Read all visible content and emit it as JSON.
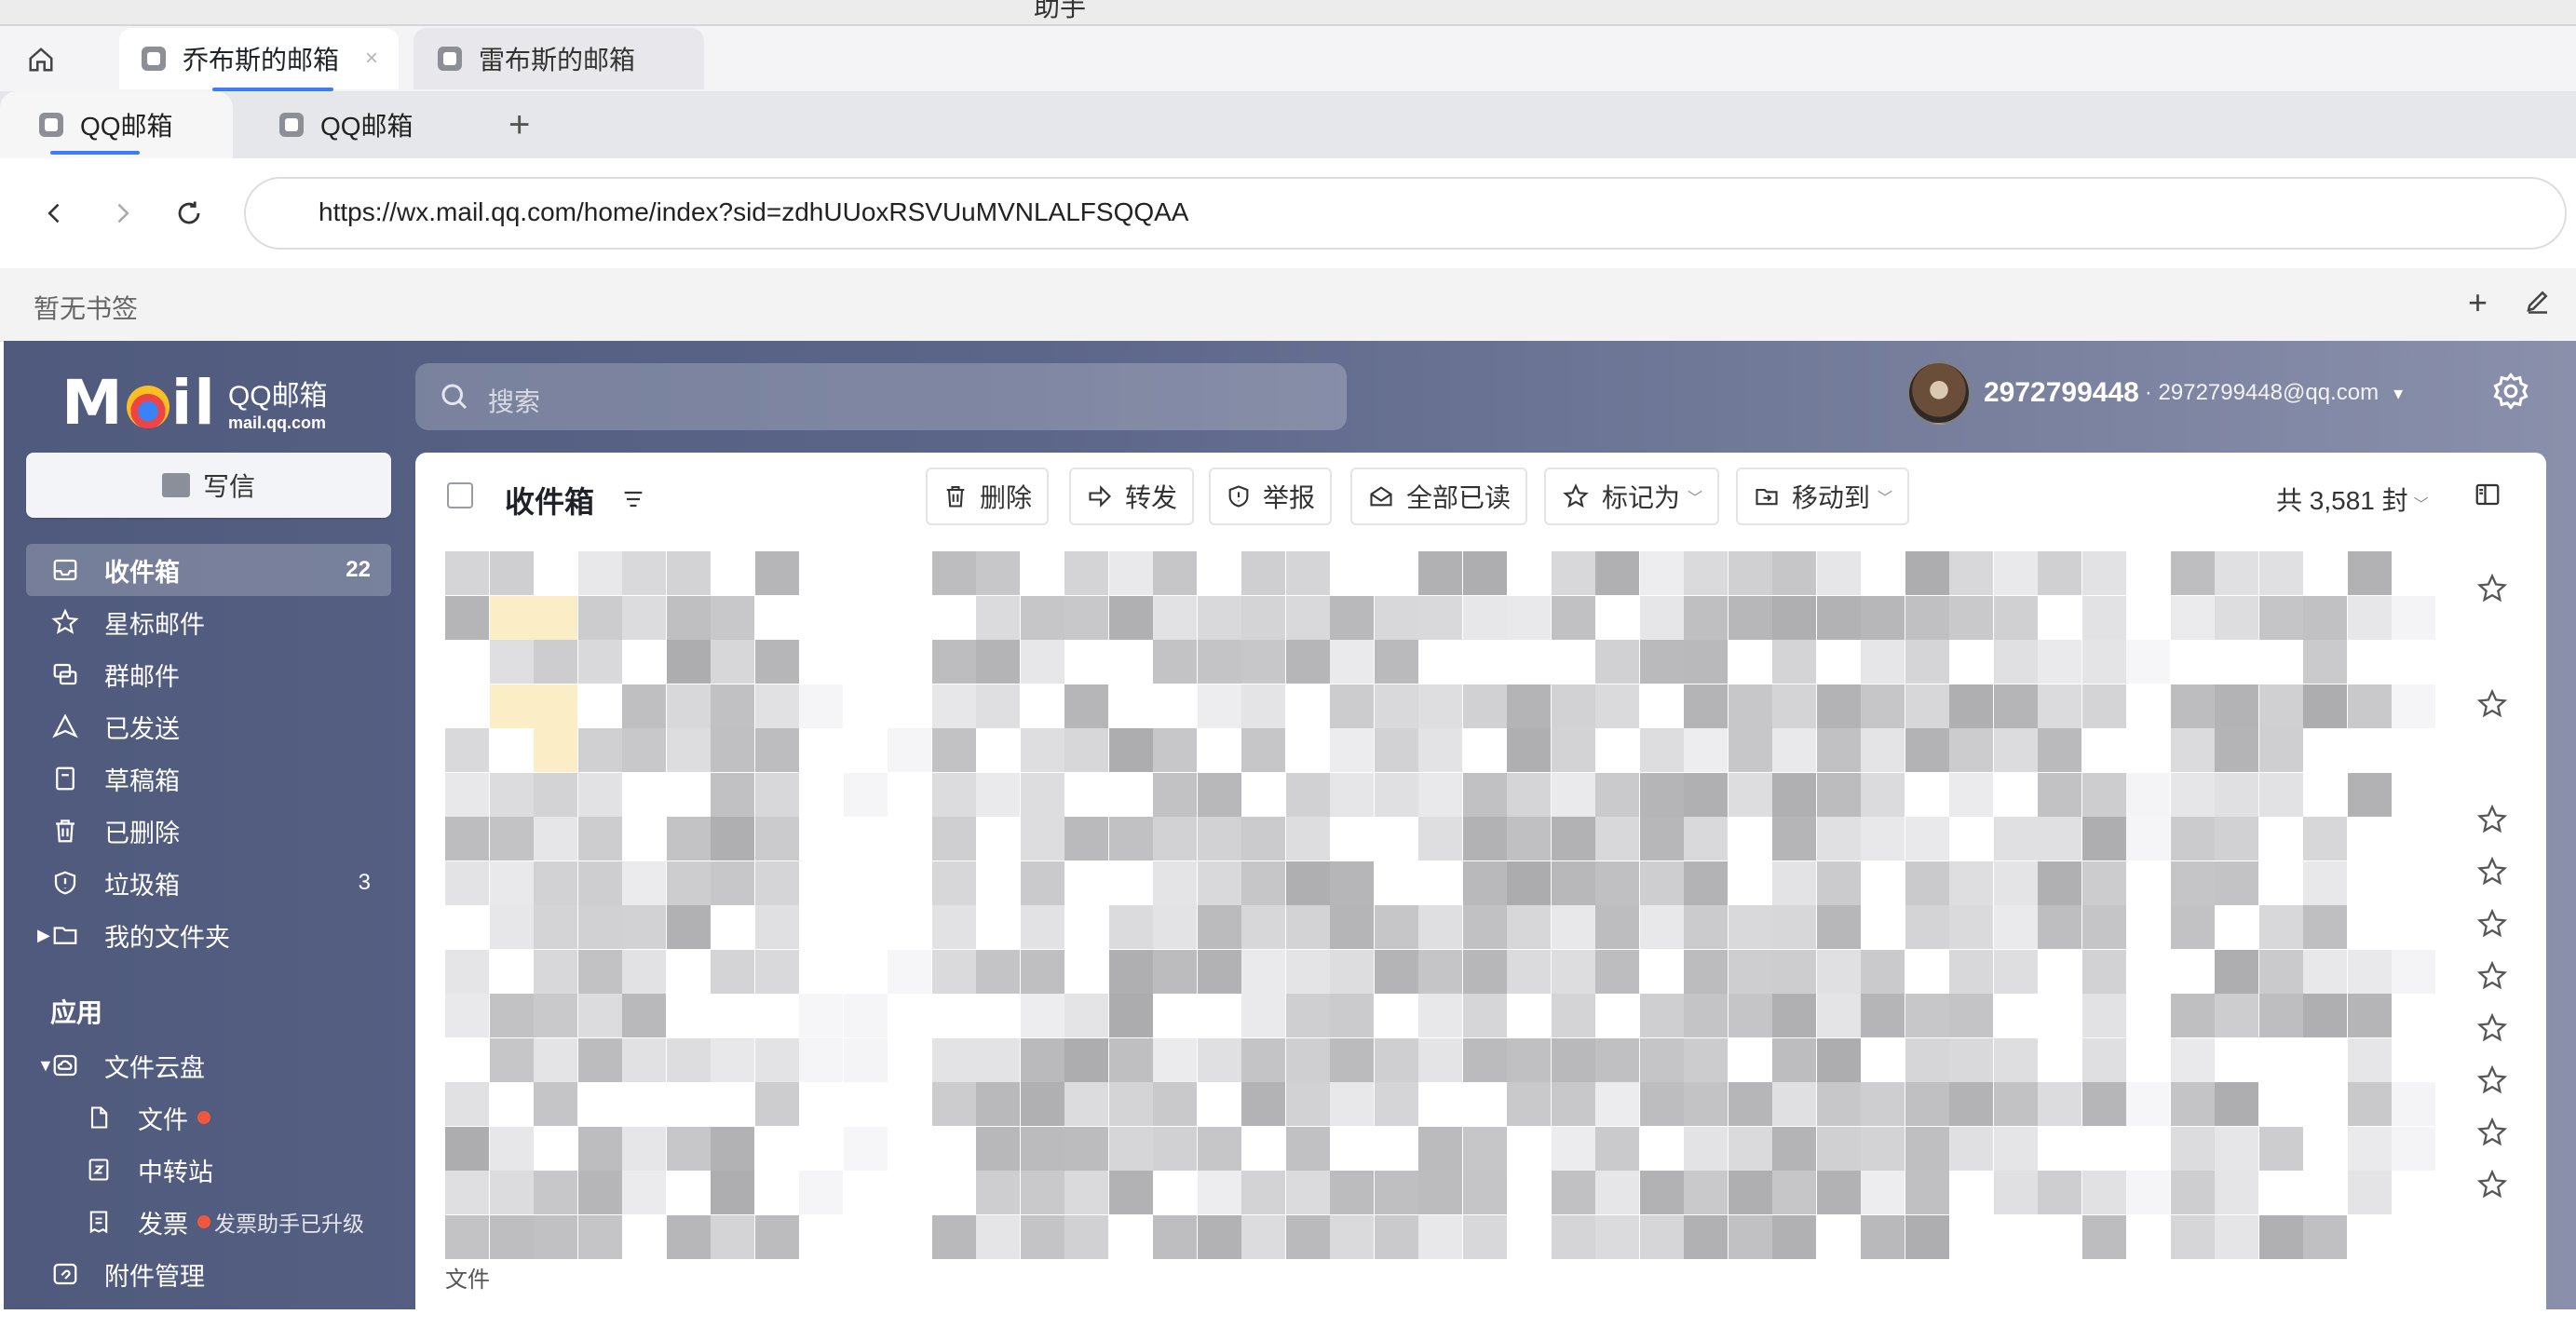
{
  "window": {
    "title": "助手"
  },
  "app_tabs": [
    {
      "label": "乔布斯的邮箱",
      "active": true
    },
    {
      "label": "雷布斯的邮箱",
      "active": false
    }
  ],
  "app_tab_close": "×",
  "browser_tabs": [
    {
      "label": "QQ邮箱",
      "active": true
    },
    {
      "label": "QQ邮箱",
      "active": false
    }
  ],
  "new_tab_label": "+",
  "address_bar": {
    "url": "https://wx.mail.qq.com/home/index?sid=zdhUUoxRSVUuMVNLALFSQQAA"
  },
  "bookmarks": {
    "empty_text": "暂无书签",
    "add": "+"
  },
  "mail": {
    "logo": {
      "word": "M  il",
      "brand_cn": "QQ邮箱",
      "brand_en": "mail.qq.com"
    },
    "search": {
      "placeholder": "搜索"
    },
    "account": {
      "uid": "2972799448",
      "email": "· 2972799448@qq.com",
      "caret": "▾"
    },
    "compose_label": "写信",
    "sidebar": {
      "items": [
        {
          "label": "收件箱",
          "count": "22",
          "icon": "inbox-icon",
          "active": true
        },
        {
          "label": "星标邮件",
          "count": "",
          "icon": "star-icon"
        },
        {
          "label": "群邮件",
          "count": "",
          "icon": "group-mail-icon"
        },
        {
          "label": "已发送",
          "count": "",
          "icon": "sent-icon"
        },
        {
          "label": "草稿箱",
          "count": "",
          "icon": "draft-icon"
        },
        {
          "label": "已删除",
          "count": "",
          "icon": "trash-icon"
        },
        {
          "label": "垃圾箱",
          "count": "3",
          "icon": "spam-icon"
        },
        {
          "label": "我的文件夹",
          "count": "",
          "icon": "folder-icon"
        }
      ],
      "apps_title": "应用",
      "apps": [
        {
          "label": "文件云盘",
          "icon": "cloud-drive-icon"
        },
        {
          "label": "文件",
          "icon": "file-icon",
          "dot": true
        },
        {
          "label": "中转站",
          "icon": "transfer-icon"
        },
        {
          "label": "发票",
          "icon": "invoice-icon",
          "dot": true,
          "note": "发票助手已升级"
        },
        {
          "label": "附件管理",
          "icon": "attachment-icon"
        }
      ]
    },
    "toolbar": {
      "folder_title": "收件箱",
      "delete": "删除",
      "forward": "转发",
      "report": "举报",
      "mark_all_read": "全部已读",
      "mark_as": "标记为",
      "move_to": "移动到",
      "total": "共 3,581 封"
    },
    "list_footer": "文件",
    "colors": {
      "accent": "#3b7cff",
      "sidebar": "#545f82",
      "badge_dot": "#f0583e"
    }
  }
}
